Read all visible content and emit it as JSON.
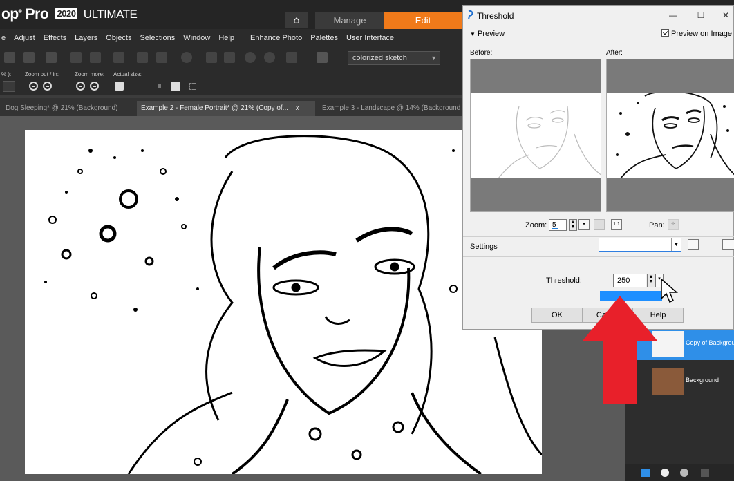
{
  "app": {
    "brand_prefix": "op",
    "brand_name": "Pro",
    "year": "2020",
    "edition": "ULTIMATE"
  },
  "workspace_tabs": {
    "manage": "Manage",
    "edit": "Edit"
  },
  "menu": [
    "e",
    "Adjust",
    "Effects",
    "Layers",
    "Objects",
    "Selections",
    "Window",
    "Help",
    "Enhance Photo",
    "Palettes",
    "User Interface"
  ],
  "toolbar": {
    "preset_combo": "colorized sketch"
  },
  "zoombar": {
    "zoom_pct_label": "% ):",
    "zoom_out_in_label": "Zoom out / in:",
    "zoom_more_label": "Zoom more:",
    "actual_size_label": "Actual size:"
  },
  "doc_tabs": [
    "Dog Sleeping* @  21% (Background)",
    "Example 2 - Female Portrait* @  21% (Copy of...",
    "Example 3 - Landscape @  14% (Background"
  ],
  "doc_tab_close": "x",
  "layers": [
    {
      "name": "Copy of Background",
      "selected": true
    },
    {
      "name": "Background",
      "selected": false
    }
  ],
  "dialog": {
    "title": "Threshold",
    "preview_toggle": "Preview",
    "preview_on_image": "Preview on Image",
    "before_label": "Before:",
    "after_label": "After:",
    "zoom_label": "Zoom:",
    "zoom_value": "5",
    "pan_label": "Pan:",
    "settings_label": "Settings",
    "threshold_label": "Threshold:",
    "threshold_value": "250",
    "ok": "OK",
    "cancel": "Cancel",
    "help": "Help",
    "minimize": "—",
    "maximize": "☐",
    "close": "✕"
  },
  "colors": {
    "edit_tab": "#f07a1a",
    "selection_blue": "#2f8fe8",
    "arrow_red": "#e8202a"
  }
}
